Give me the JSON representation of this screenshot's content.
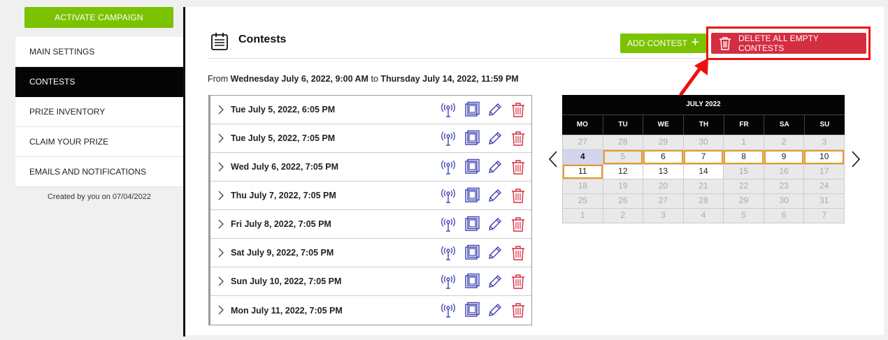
{
  "sidebar": {
    "activate_label": "ACTIVATE CAMPAIGN",
    "items": [
      {
        "label": "MAIN SETTINGS",
        "active": false
      },
      {
        "label": "CONTESTS",
        "active": true
      },
      {
        "label": "PRIZE INVENTORY",
        "active": false
      },
      {
        "label": "CLAIM YOUR PRIZE",
        "active": false
      },
      {
        "label": "EMAILS AND NOTIFICATIONS",
        "active": false
      }
    ],
    "created_text": "Created by you on 07/04/2022"
  },
  "header": {
    "title": "Contests",
    "add_label": "ADD CONTEST",
    "add_icon": "+",
    "delete_label": "DELETE ALL EMPTY CONTESTS"
  },
  "date_range": {
    "prefix": "From",
    "start": "Wednesday July 6, 2022, 9:00 AM",
    "joiner": "to",
    "end": "Thursday July 14, 2022, 11:59 PM"
  },
  "contests": [
    {
      "label": "Tue July 5, 2022, 6:05 PM"
    },
    {
      "label": "Tue July 5, 2022, 7:05 PM"
    },
    {
      "label": "Wed July 6, 2022, 7:05 PM"
    },
    {
      "label": "Thu July 7, 2022, 7:05 PM"
    },
    {
      "label": "Fri July 8, 2022, 7:05 PM"
    },
    {
      "label": "Sat July 9, 2022, 7:05 PM"
    },
    {
      "label": "Sun July 10, 2022, 7:05 PM"
    },
    {
      "label": "Mon July 11, 2022, 7:05 PM"
    }
  ],
  "row_icons": [
    "broadcast-icon",
    "copy-icon",
    "edit-icon",
    "delete-icon"
  ],
  "calendar": {
    "month": "JULY 2022",
    "weekdays": [
      "MO",
      "TU",
      "WE",
      "TH",
      "FR",
      "SA",
      "SU"
    ],
    "weeks": [
      [
        {
          "d": "27",
          "dim": true
        },
        {
          "d": "28",
          "dim": true
        },
        {
          "d": "29",
          "dim": true
        },
        {
          "d": "30",
          "dim": true
        },
        {
          "d": "1",
          "dim": true
        },
        {
          "d": "2",
          "dim": true
        },
        {
          "d": "3",
          "dim": true
        }
      ],
      [
        {
          "d": "4",
          "today": true
        },
        {
          "d": "5",
          "dim": true,
          "sel": true
        },
        {
          "d": "6",
          "sel": true
        },
        {
          "d": "7",
          "sel": true
        },
        {
          "d": "8",
          "sel": true
        },
        {
          "d": "9",
          "sel": true
        },
        {
          "d": "10",
          "sel": true
        }
      ],
      [
        {
          "d": "11",
          "sel": true
        },
        {
          "d": "12"
        },
        {
          "d": "13"
        },
        {
          "d": "14"
        },
        {
          "d": "15",
          "dim": true
        },
        {
          "d": "16",
          "dim": true
        },
        {
          "d": "17",
          "dim": true
        }
      ],
      [
        {
          "d": "18",
          "dim": true
        },
        {
          "d": "19",
          "dim": true
        },
        {
          "d": "20",
          "dim": true
        },
        {
          "d": "21",
          "dim": true
        },
        {
          "d": "22",
          "dim": true
        },
        {
          "d": "23",
          "dim": true
        },
        {
          "d": "24",
          "dim": true
        }
      ],
      [
        {
          "d": "25",
          "dim": true
        },
        {
          "d": "26",
          "dim": true
        },
        {
          "d": "27",
          "dim": true
        },
        {
          "d": "28",
          "dim": true
        },
        {
          "d": "29",
          "dim": true
        },
        {
          "d": "30",
          "dim": true
        },
        {
          "d": "31",
          "dim": true
        }
      ],
      [
        {
          "d": "1",
          "dim": true
        },
        {
          "d": "2",
          "dim": true
        },
        {
          "d": "3",
          "dim": true
        },
        {
          "d": "4",
          "dim": true
        },
        {
          "d": "5",
          "dim": true
        },
        {
          "d": "6",
          "dim": true
        },
        {
          "d": "7",
          "dim": true
        }
      ]
    ]
  },
  "colors": {
    "green": "#7bc300",
    "delete_red": "#d42d40",
    "highlight_red": "#ee1010",
    "icon_blue": "#3a3fb5",
    "icon_red": "#d42d40",
    "selected_orange": "#e79a25",
    "today_bg": "#d4d4ee"
  }
}
